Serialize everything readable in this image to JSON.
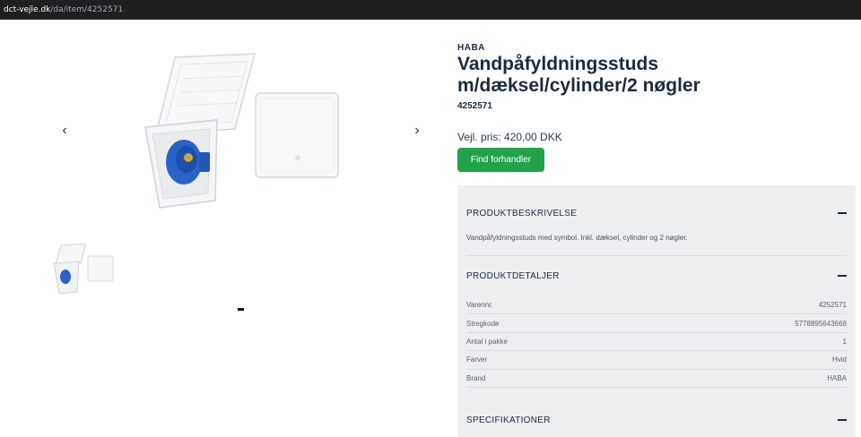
{
  "url": {
    "host": "dct-vejle.dk",
    "path": "/da/item/4252571"
  },
  "gallery": {
    "prev_icon": "chevron-left-icon",
    "next_icon": "chevron-right-icon",
    "prev_glyph": "‹",
    "next_glyph": "›"
  },
  "product": {
    "brand": "HABA",
    "title": "Vandpåfyldningsstuds m/dæksel/cylinder/2 nøgler",
    "sku": "4252571",
    "price": "Vejl. pris: 420,00 DKK",
    "cta": "Find forhandler"
  },
  "sections": [
    {
      "label": "PRODUKTBESKRIVELSE",
      "description": "Vandpåfyldningsstuds med symbol. Inkl. dæksel, cylinder og 2 nøgler."
    },
    {
      "label": "PRODUKTDETALJER"
    },
    {
      "label": "SPECIFIKATIONER"
    }
  ],
  "details": [
    {
      "key": "Varennr.",
      "value": "4252571"
    },
    {
      "key": "Stregkode",
      "value": "5778895643668"
    },
    {
      "key": "Antal i pakke",
      "value": "1"
    },
    {
      "key": "Farver",
      "value": "Hvid"
    },
    {
      "key": "Brand",
      "value": "HABA"
    }
  ],
  "colors": {
    "cta": "#22a34a",
    "panel": "#edeef0",
    "text": "#1b2b3c",
    "accent_blue": "#2a62c8"
  }
}
